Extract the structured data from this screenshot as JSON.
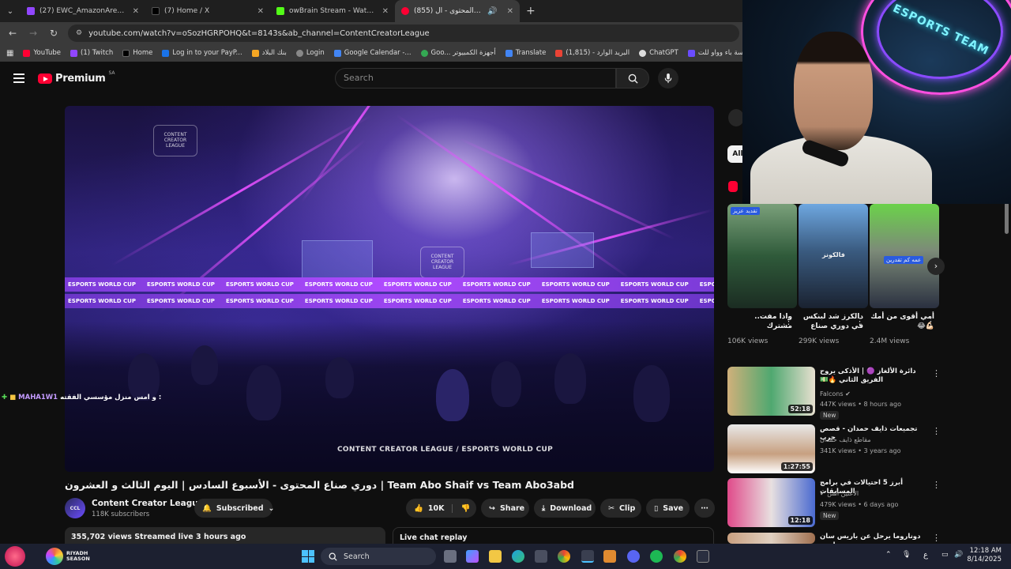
{
  "tabs": [
    {
      "title": "(27) EWC_AmazonArena_AR - Tw",
      "color": "#9146ff",
      "active": false
    },
    {
      "title": "(7) Home / X",
      "color": "#000000",
      "active": false
    },
    {
      "title": "owBrain Stream - Watch Live on",
      "color": "#53fc18",
      "active": false
    },
    {
      "title": "(855) دوري صناع المحتوى - ال",
      "color": "#ff0033",
      "active": true
    }
  ],
  "address": {
    "url": "youtube.com/watch?v=oSozHGRPOHQ&t=8143s&ab_channel=ContentCreatorLeague"
  },
  "bookmarks": [
    {
      "label": "YouTube",
      "color": "#ff0033"
    },
    {
      "label": "(1) Twitch",
      "color": "#9146ff"
    },
    {
      "label": "Home",
      "color": "#000000"
    },
    {
      "label": "Log in to your PayP...",
      "color": "#1a73e8"
    },
    {
      "label": "بنك البلاد",
      "color": "#f5a623"
    },
    {
      "label": "Login",
      "color": "#888888"
    },
    {
      "label": "Google Calendar -...",
      "color": "#4285f4"
    },
    {
      "label": "Goo... أجهزة الكمبيوتر",
      "color": "#34a853"
    },
    {
      "label": "Translate",
      "color": "#4285f4"
    },
    {
      "label": "(1,815) - البريد الوارد",
      "color": "#ea4335"
    },
    {
      "label": "ChatGPT",
      "color": "#dddddd"
    },
    {
      "label": "مؤسسة باء وواو للت...",
      "color": "#6a4cff"
    }
  ],
  "header": {
    "logo": "Premium",
    "country": "SA",
    "search_placeholder": "Search"
  },
  "player": {
    "watermark": "CONTENT CREATOR LEAGUE / ESPORTS WORLD CUP",
    "band_text": "ESPORTS WORLD CUP",
    "badge_text": "CONTENT CREATOR LEAGUE"
  },
  "overlay_chat": {
    "username": "MAHA1W1",
    "message": "و امس منزل مؤسسي الفقته :"
  },
  "video": {
    "title": "دوري صناع المحتوى - الأسبوع السادس | اليوم الثالث و العشرون | Team Abo Shaif vs Team Abo3abd",
    "channel": "Content Creator League",
    "subscribers": "118K subscribers",
    "subscribe_label": "Subscribed",
    "likes": "10K",
    "share_label": "Share",
    "download_label": "Download",
    "clip_label": "Clip",
    "save_label": "Save",
    "views_line": "355,702 views  Streamed live 3 hours ago",
    "chat_replay": "Live chat replay"
  },
  "sidebar": {
    "chip_label": "All",
    "shorts": [
      {
        "title": "واذا مفت.. مشترك",
        "views": "106K views",
        "caption": "تقديد عزيز"
      },
      {
        "title": "دالكرز شد لبنكس في دوري صناع",
        "views": "299K views",
        "caption": "فالكونز"
      },
      {
        "title": "أمي أقوى من أمك 💪🏻😂",
        "views": "2.4M views",
        "caption": "عمه كم تقدرين"
      }
    ],
    "videos": [
      {
        "title": "دائرة الألغاز 🟣 | الأذكى يروح الفريق الثاني 🔥💵",
        "channel": "Falcons",
        "meta": "447K views • 8 hours ago",
        "duration": "52:18",
        "badge": "New"
      },
      {
        "title": "تجميعات ذايف حمدان - قصص حرب",
        "channel": "مقاطع ذايف حمدان",
        "meta": "341K views • 3 years ago",
        "duration": "1:27:55",
        "badge": ""
      },
      {
        "title": "أبرز 5 احتيالات في برامج المسابقات",
        "channel": "الأعنين الس",
        "meta": "479K views • 6 days ago",
        "duration": "12:18",
        "badge": "New"
      },
      {
        "title": "دوناروما يرحل عن باريس سان جيرمان ..",
        "channel": "",
        "meta": "",
        "duration": "",
        "badge": ""
      }
    ]
  },
  "webcam": {
    "neon_text": "ESPORTS TEAM"
  },
  "taskbar": {
    "search_label": "Search",
    "season_label": "RIYADH SEASON",
    "time": "12:18 AM",
    "date": "8/14/2025",
    "lang": "ع"
  }
}
